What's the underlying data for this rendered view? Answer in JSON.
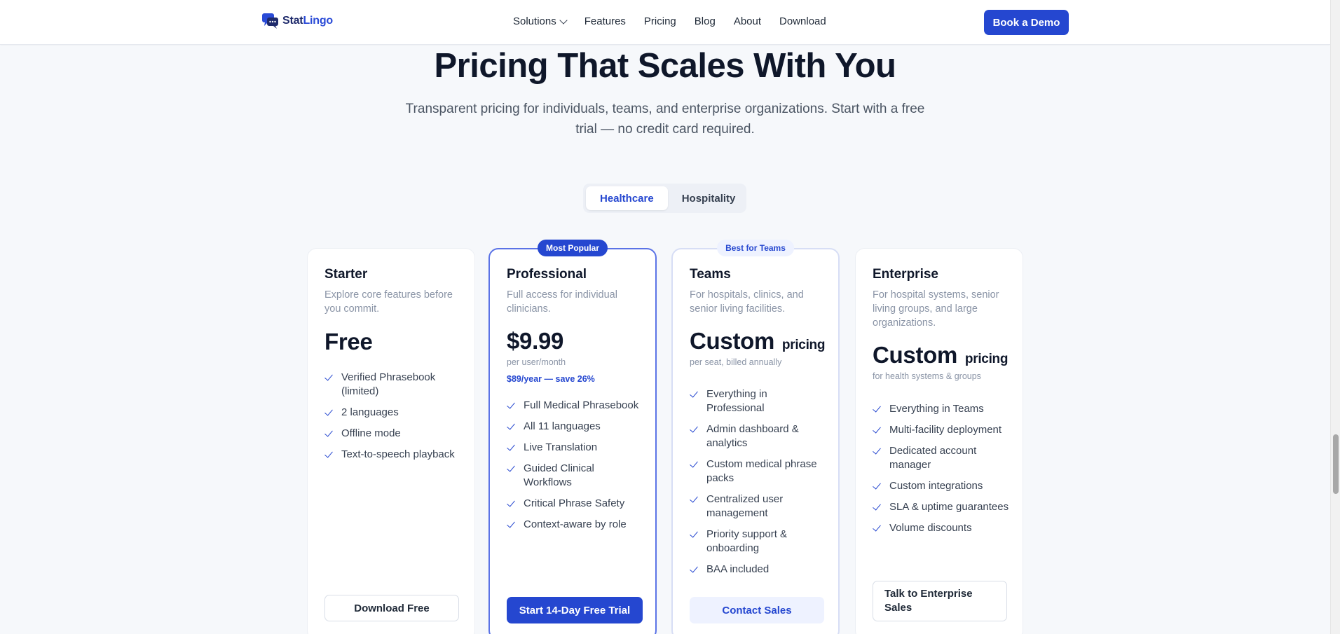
{
  "header": {
    "logo": {
      "part1": "Stat",
      "part2": "Lingo",
      "icon": "chat-bubbles-icon"
    },
    "nav": [
      {
        "label": "Solutions",
        "has_dropdown": true
      },
      {
        "label": "Features"
      },
      {
        "label": "Pricing"
      },
      {
        "label": "Blog"
      },
      {
        "label": "About"
      },
      {
        "label": "Download"
      }
    ],
    "cta_label": "Book a Demo"
  },
  "hero": {
    "title": "Pricing That Scales With You",
    "subtitle": "Transparent pricing for individuals, teams, and enterprise organizations. Start with a free trial — no credit card required."
  },
  "toggle": {
    "options": [
      "Healthcare",
      "Hospitality"
    ],
    "selected": "Healthcare"
  },
  "plans": [
    {
      "name": "Starter",
      "description": "Explore core features before you commit.",
      "price": "Free",
      "features": [
        "Verified Phrasebook (limited)",
        "2 languages",
        "Offline mode",
        "Text-to-speech playback"
      ],
      "cta": "Download Free"
    },
    {
      "badge": "Most Popular",
      "name": "Professional",
      "description": "Full access for individual clinicians.",
      "price": "$9.99",
      "price_note": "per user/month",
      "price_save": "$89/year — save 26%",
      "features": [
        "Full Medical Phrasebook",
        "All 11 languages",
        "Live Translation",
        "Guided Clinical Workflows",
        "Critical Phrase Safety",
        "Context-aware by role"
      ],
      "cta": "Start 14-Day Free Trial"
    },
    {
      "badge": "Best for Teams",
      "name": "Teams",
      "description": "For hospitals, clinics, and senior living facilities.",
      "price": "Custom",
      "price_unit": "pricing",
      "price_note": "per seat, billed annually",
      "features": [
        "Everything in Professional",
        "Admin dashboard & analytics",
        "Custom medical phrase packs",
        "Centralized user management",
        "Priority support & onboarding",
        "BAA included"
      ],
      "cta": "Contact Sales"
    },
    {
      "name": "Enterprise",
      "description": "For hospital systems, senior living groups, and large organizations.",
      "price": "Custom",
      "price_unit": "pricing",
      "price_note": "for health systems & groups",
      "features": [
        "Everything in Teams",
        "Multi-facility deployment",
        "Dedicated account manager",
        "Custom integrations",
        "SLA & uptime guarantees",
        "Volume discounts"
      ],
      "cta": "Talk to Enterprise Sales"
    }
  ],
  "colors": {
    "accent": "#2547d0",
    "muted": "#8a94a6",
    "background": "#f6f8fb"
  }
}
